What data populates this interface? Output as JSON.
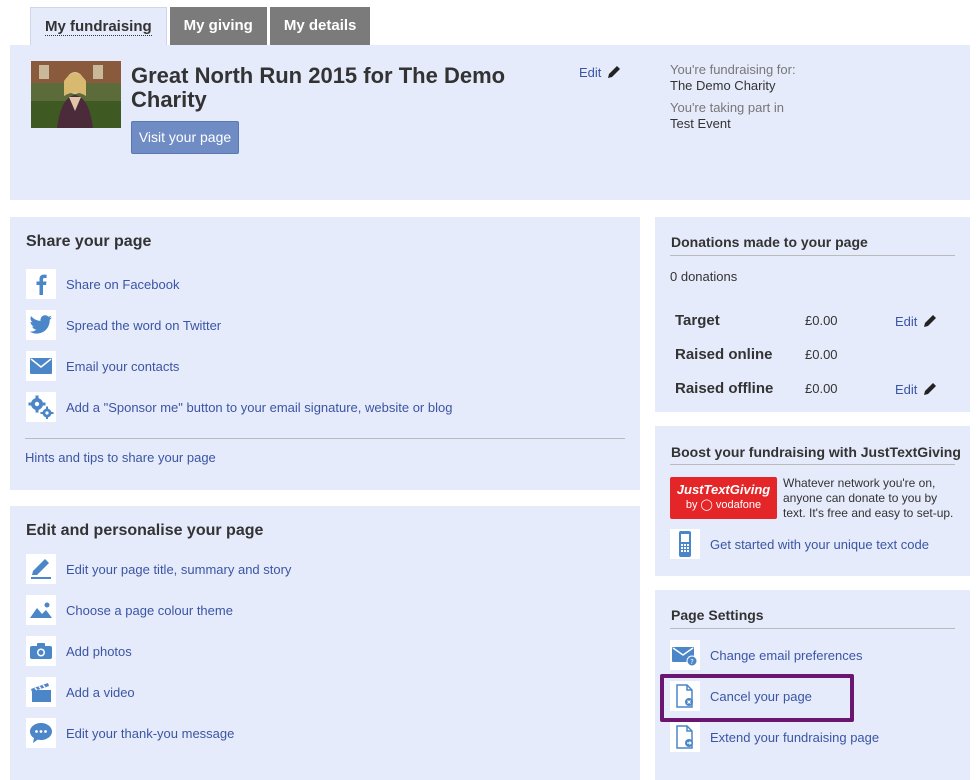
{
  "tabs": [
    {
      "label": "My fundraising",
      "active": true
    },
    {
      "label": "My giving",
      "active": false
    },
    {
      "label": "My details",
      "active": false
    }
  ],
  "header": {
    "page_title": "Great North Run 2015 for The Demo Charity",
    "visit_button": "Visit your page",
    "edit_label": "Edit",
    "fundraising_for_label": "You're fundraising for:",
    "fundraising_for_value": "The Demo Charity",
    "taking_part_label": "You're taking part in",
    "taking_part_value": "Test Event"
  },
  "share": {
    "title": "Share your page",
    "items": [
      {
        "label": "Share on Facebook",
        "icon": "facebook-icon"
      },
      {
        "label": "Spread the word on Twitter",
        "icon": "twitter-icon"
      },
      {
        "label": "Email your contacts",
        "icon": "email-icon"
      },
      {
        "label": "Add a \"Sponsor me\" button to your email signature, website or blog",
        "icon": "gears-icon"
      }
    ],
    "hints_link": "Hints and tips to share your page"
  },
  "personalise": {
    "title": "Edit and personalise your page",
    "items": [
      {
        "label": "Edit your page title, summary and story",
        "icon": "pencil-icon"
      },
      {
        "label": "Choose a page colour theme",
        "icon": "landscape-icon"
      },
      {
        "label": "Add photos",
        "icon": "camera-icon"
      },
      {
        "label": "Add a video",
        "icon": "clapperboard-icon"
      },
      {
        "label": "Edit your thank-you message",
        "icon": "speech-bubble-icon"
      }
    ]
  },
  "donations": {
    "title": "Donations made to your page",
    "count": "0 donations",
    "rows": [
      {
        "label": "Target",
        "value": "£0.00",
        "edit": "Edit"
      },
      {
        "label": "Raised online",
        "value": "£0.00",
        "edit": ""
      },
      {
        "label": "Raised offline",
        "value": "£0.00",
        "edit": "Edit"
      }
    ]
  },
  "boost": {
    "title": "Boost your fundraising with JustTextGiving",
    "logo_line1": "JustTextGiving",
    "logo_line2": "by ◯ vodafone",
    "text": "Whatever network you're on, anyone can donate to you by text. It's free and easy to set-up.",
    "link": "Get started with your unique text code"
  },
  "settings": {
    "title": "Page Settings",
    "items": [
      {
        "label": "Change email preferences",
        "icon": "email-settings-icon"
      },
      {
        "label": "Cancel your page",
        "icon": "cancel-page-icon"
      },
      {
        "label": "Extend your fundraising page",
        "icon": "extend-page-icon"
      }
    ]
  },
  "colors": {
    "panel_bg": "#e6ebfb",
    "link": "#3a55a4",
    "icon_blue": "#4a86c8",
    "tab_inactive": "#7b7b7b",
    "highlight": "#6a1670",
    "jtg_red": "#e52629"
  }
}
